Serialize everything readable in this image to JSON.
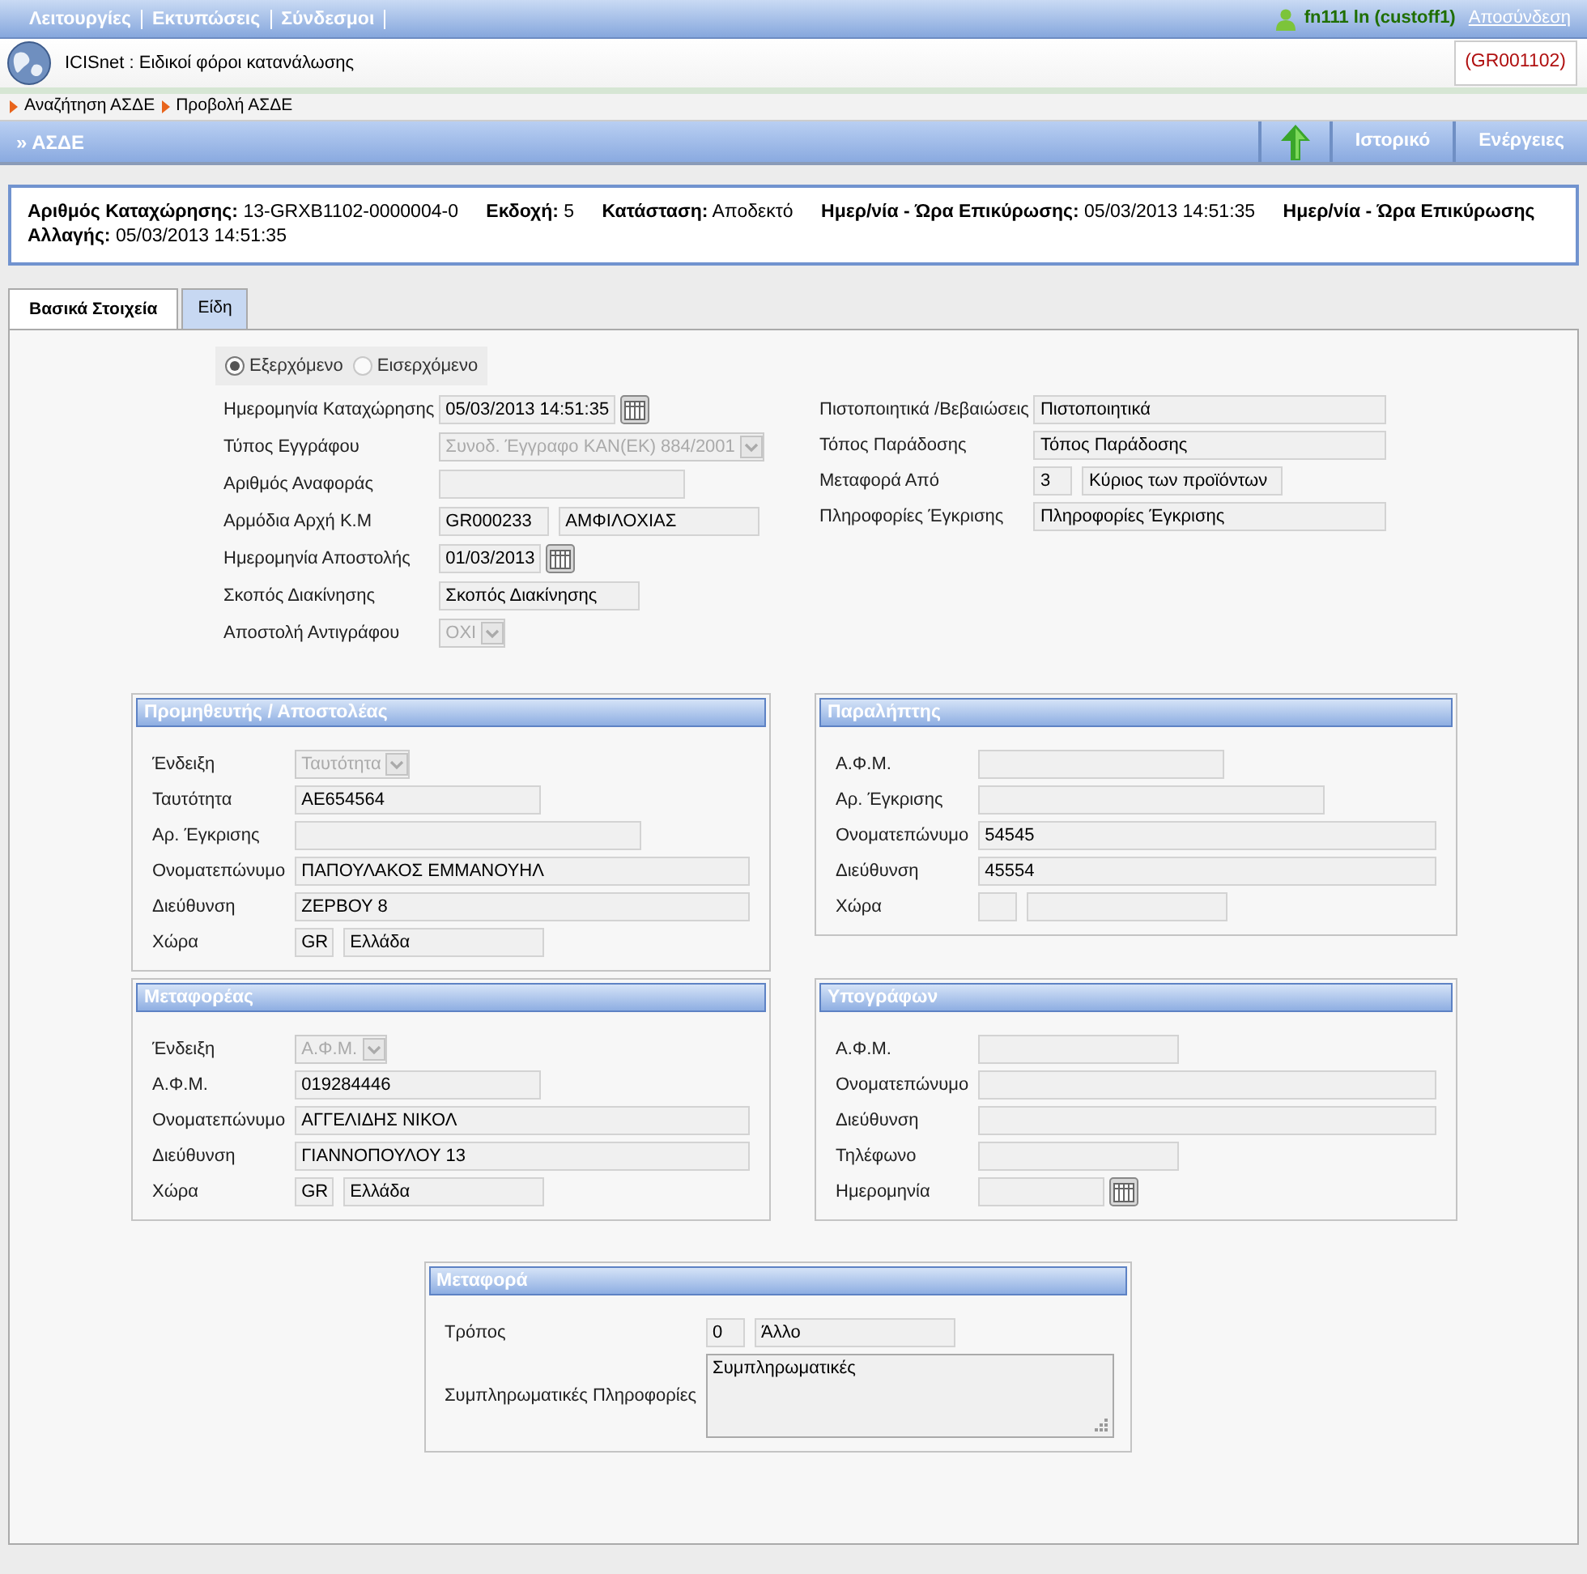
{
  "menu": {
    "items": [
      "Λειτουργίες",
      "Εκτυπώσεις",
      "Σύνδεσμοι"
    ],
    "user": "fn111 ln (custoff1)",
    "logout": "Αποσύνδεση"
  },
  "app": {
    "title": "ICISnet : Ειδικοί φόροι κατανάλωσης",
    "office": "(GR001102)"
  },
  "breadcrumb": [
    "Αναζήτηση ΑΣΔΕ",
    "Προβολή ΑΣΔΕ"
  ],
  "section": {
    "title": "» ΑΣΔΕ",
    "actions": [
      "Ιστορικό",
      "Ενέργειες"
    ]
  },
  "summary": [
    {
      "label": "Αριθμός Καταχώρησης:",
      "value": "13-GRXB1102-0000004-0"
    },
    {
      "label": "Εκδοχή:",
      "value": "5"
    },
    {
      "label": "Κατάσταση:",
      "value": "Αποδεκτό"
    },
    {
      "label": "Ημερ/νία - Ώρα Επικύρωσης:",
      "value": "05/03/2013 14:51:35"
    },
    {
      "label": "Ημερ/νία - Ώρα Επικύρωσης Αλλαγής:",
      "value": "05/03/2013 14:51:35"
    }
  ],
  "tabs": [
    {
      "label": "Βασικά Στοιχεία",
      "selected": true
    },
    {
      "label": "Είδη",
      "selected": false
    }
  ],
  "direction": [
    {
      "label": "Εξερχόμενο",
      "selected": true
    },
    {
      "label": "Εισερχόμενο",
      "selected": false
    }
  ],
  "form_left": [
    {
      "label": "Ημερομηνία Καταχώρησης",
      "controls": [
        {
          "kind": "date",
          "value": "05/03/2013 14:51:35"
        }
      ]
    },
    {
      "label": "Τύπος Εγγράφου",
      "controls": [
        {
          "kind": "select",
          "value": "Συνοδ. Έγγραφο ΚΑΝ(ΕΚ) 884/2001",
          "disabled": true
        }
      ]
    },
    {
      "label": "Αριθμός Αναφοράς",
      "controls": [
        {
          "kind": "medium"
        }
      ]
    },
    {
      "label": "Αρμόδια Αρχή Κ.Μ",
      "controls": [
        {
          "kind": "code",
          "value": "GR000233"
        },
        {
          "kind": "short",
          "value": "ΑΜΦΙΛΟΧΙΑΣ"
        }
      ]
    },
    {
      "label": "Ημερομηνία Αποστολής",
      "controls": [
        {
          "kind": "date",
          "value": "01/03/2013"
        }
      ]
    },
    {
      "label": "Σκοπός Διακίνησης",
      "controls": [
        {
          "kind": "short",
          "value": "Σκοπός Διακίνησης"
        }
      ]
    },
    {
      "label": "Αποστολή Αντιγράφου",
      "controls": [
        {
          "kind": "select",
          "value": "ΟΧΙ",
          "disabled": true
        }
      ]
    }
  ],
  "form_right": [
    {
      "label": "Πιστοποιητικά /Βεβαιώσεις",
      "controls": [
        {
          "kind": "full",
          "value": "Πιστοποιητικά"
        }
      ]
    },
    {
      "label": "Τόπος Παράδοσης",
      "controls": [
        {
          "kind": "full",
          "value": "Τόπος Παράδοσης"
        }
      ]
    },
    {
      "label": "Μεταφορά Από",
      "controls": [
        {
          "kind": "tiny",
          "value": "3"
        },
        {
          "kind": "short",
          "value": "Κύριος των προϊόντων"
        }
      ]
    },
    {
      "label": "Πληροφορίες Έγκρισης",
      "controls": [
        {
          "kind": "full",
          "value": "Πληροφορίες Έγκρισης"
        }
      ]
    }
  ],
  "panels": [
    {
      "title": "Προμηθευτής / Αποστολέας",
      "rows": [
        {
          "label": "Ένδειξη",
          "controls": [
            {
              "kind": "select",
              "value": "Ταυτότητα",
              "disabled": true
            }
          ]
        },
        {
          "label": "Ταυτότητα",
          "controls": [
            {
              "kind": "medium",
              "value": "ΑΕ654564"
            }
          ]
        },
        {
          "label": "Αρ. Έγκρισης",
          "controls": [
            {
              "kind": "long"
            }
          ]
        },
        {
          "label": "Ονοματεπώνυμο",
          "controls": [
            {
              "kind": "full",
              "value": "ΠΑΠΟΥΛΑΚΟΣ ΕΜΜΑΝΟΥΗΛ"
            }
          ]
        },
        {
          "label": "Διεύθυνση",
          "controls": [
            {
              "kind": "full",
              "value": "ΖΕΡΒΟΥ 8"
            }
          ]
        },
        {
          "label": "Χώρα",
          "controls": [
            {
              "kind": "tiny",
              "value": "GR"
            },
            {
              "kind": "short",
              "value": "Ελλάδα"
            }
          ]
        }
      ]
    },
    {
      "title": "Παραλήπτης",
      "rows": [
        {
          "label": "Α.Φ.Μ.",
          "controls": [
            {
              "kind": "medium"
            }
          ]
        },
        {
          "label": "Αρ. Έγκρισης",
          "controls": [
            {
              "kind": "long"
            }
          ]
        },
        {
          "label": "Ονοματεπώνυμο",
          "controls": [
            {
              "kind": "full",
              "value": "54545"
            }
          ]
        },
        {
          "label": "Διεύθυνση",
          "controls": [
            {
              "kind": "full",
              "value": "45554"
            }
          ]
        },
        {
          "label": "Χώρα",
          "controls": [
            {
              "kind": "tiny"
            },
            {
              "kind": "short"
            }
          ]
        }
      ]
    },
    {
      "title": "Μεταφορέας",
      "rows": [
        {
          "label": "Ένδειξη",
          "controls": [
            {
              "kind": "select",
              "value": "Α.Φ.Μ.",
              "disabled": true
            }
          ]
        },
        {
          "label": "Α.Φ.Μ.",
          "controls": [
            {
              "kind": "medium",
              "value": "019284446"
            }
          ]
        },
        {
          "label": "Ονοματεπώνυμο",
          "controls": [
            {
              "kind": "full",
              "value": "ΑΓΓΕΛΙΔΗΣ ΝΙΚΟΛ"
            }
          ]
        },
        {
          "label": "Διεύθυνση",
          "controls": [
            {
              "kind": "full",
              "value": "ΓΙΑΝΝΟΠΟΥΛΟΥ 13"
            }
          ]
        },
        {
          "label": "Χώρα",
          "controls": [
            {
              "kind": "tiny",
              "value": "GR"
            },
            {
              "kind": "short",
              "value": "Ελλάδα"
            }
          ]
        }
      ]
    },
    {
      "title": "Υπογράφων",
      "rows": [
        {
          "label": "Α.Φ.Μ.",
          "controls": [
            {
              "kind": "short"
            }
          ]
        },
        {
          "label": "Ονοματεπώνυμο",
          "controls": [
            {
              "kind": "full"
            }
          ]
        },
        {
          "label": "Διεύθυνση",
          "controls": [
            {
              "kind": "full"
            }
          ]
        },
        {
          "label": "Τηλέφωνο",
          "controls": [
            {
              "kind": "short"
            }
          ]
        },
        {
          "label": "Ημερομηνία",
          "controls": [
            {
              "kind": "date"
            }
          ]
        }
      ]
    },
    {
      "title": "Μεταφορά",
      "rows": [
        {
          "label": "Τρόπος",
          "controls": [
            {
              "kind": "tiny",
              "value": "0"
            },
            {
              "kind": "short",
              "value": "Άλλο"
            }
          ]
        },
        {
          "label": "Συμπληρωματικές Πληροφορίες",
          "controls": [
            {
              "kind": "memo",
              "value": "Συμπληρωματικές"
            }
          ]
        }
      ]
    }
  ]
}
